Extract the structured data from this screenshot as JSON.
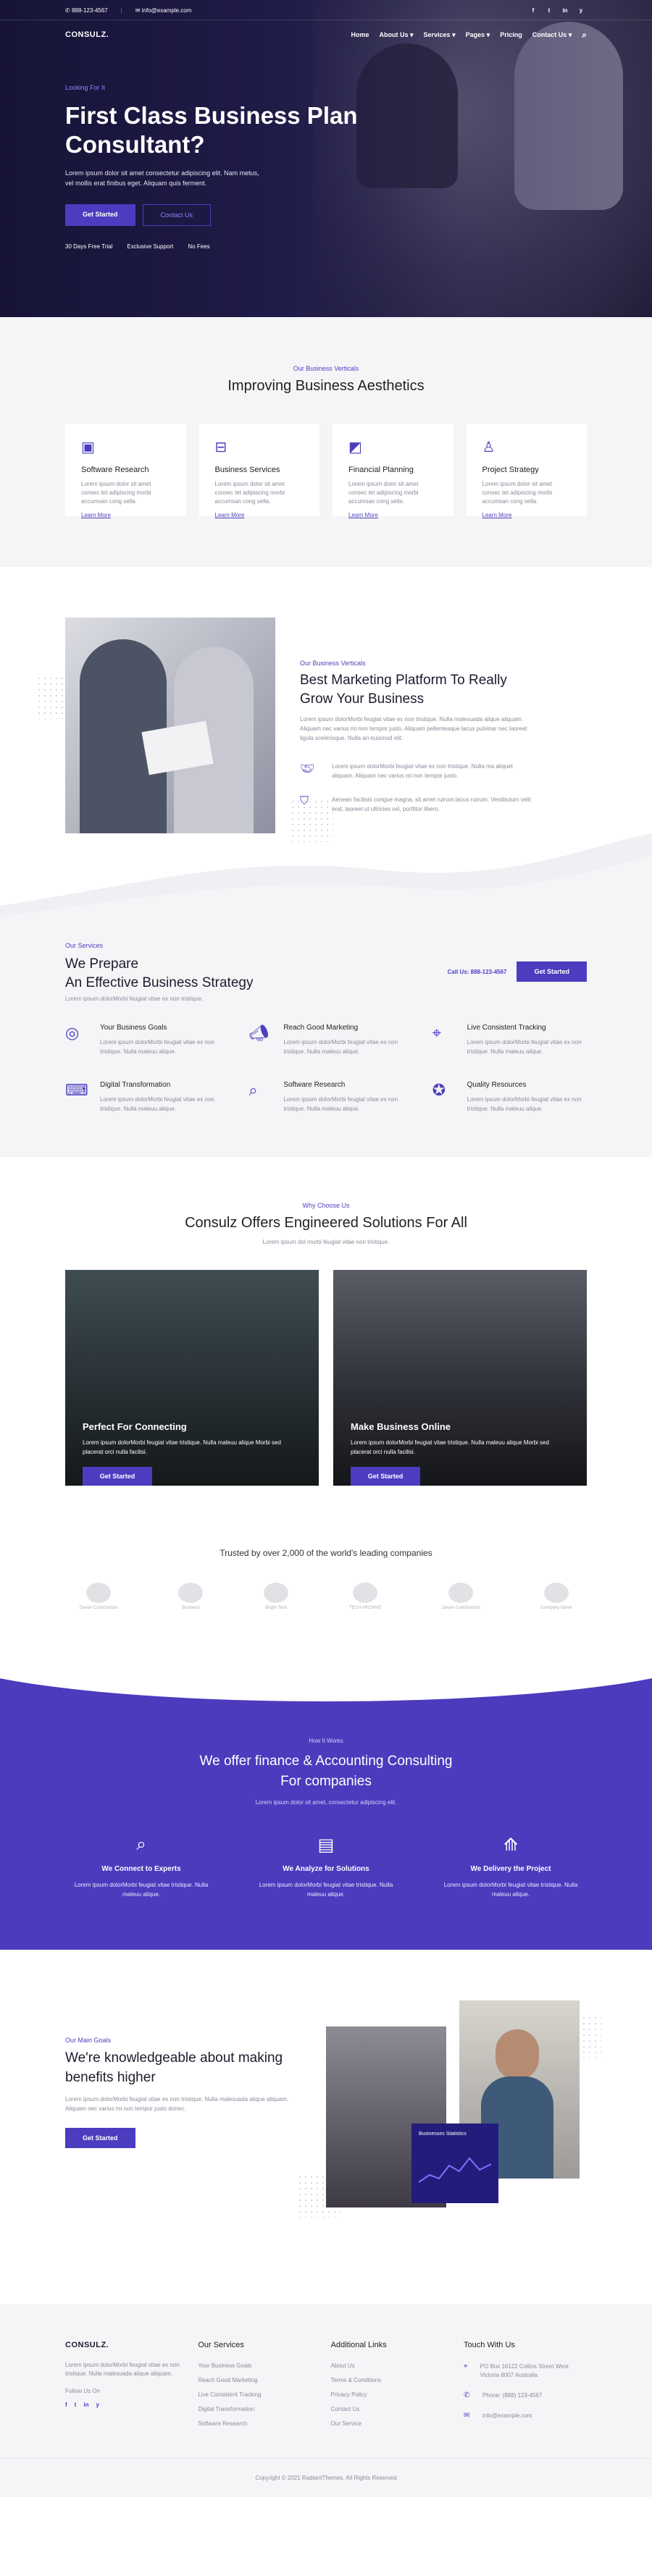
{
  "topbar": {
    "phone": "888-123-4567",
    "email": "info@example.com",
    "social": [
      "f",
      "t",
      "in",
      "y"
    ]
  },
  "nav": {
    "logo": "CONSULZ.",
    "items": [
      "Home",
      "About Us",
      "Services",
      "Pages",
      "Pricing",
      "Contact Us"
    ]
  },
  "hero": {
    "kicker": "Looking For It",
    "title": "First Class Business Plan Consultant?",
    "text": "Lorem ipsum dolor sit amet consectetur adipiscing elit. Nam metus, vel mollis erat finibus eget. Aliquam quis ferment.",
    "btn_primary": "Get Started",
    "btn_secondary": "Contact Us",
    "features": [
      "30 Days Free Trial",
      "Exclusive Support",
      "No Fees"
    ]
  },
  "verticals": {
    "kicker": "Our Business Verticals",
    "title": "Improving Business Aesthetics",
    "cards": [
      {
        "title": "Software Research",
        "text": "Lorem ipsum dolor sit amet consec tet adipiscing morbi accumsan cong sella.",
        "link": "Learn More"
      },
      {
        "title": "Business Services",
        "text": "Lorem ipsum dolor sit amet consec tet adipiscing morbi accumsan cong sella.",
        "link": "Learn More"
      },
      {
        "title": "Financial Planning",
        "text": "Lorem ipsum dolor sit amet consec tet adipiscing morbi accumsan cong sella.",
        "link": "Learn More"
      },
      {
        "title": "Project Strategy",
        "text": "Lorem ipsum dolor sit amet consec tet adipiscing morbi accumsan cong sella.",
        "link": "Learn More"
      }
    ]
  },
  "marketing": {
    "kicker": "Our Business Verticals",
    "title": "Best Marketing Platform To Really Grow Your Business",
    "text": "Lorem ipsum dolorMorbi feugiat vitae ex non tristique. Nulla malesuada alique aliquam. Aliquam nec varius mi non tempor justo. Aliquam pellentesque lacus pulvinar nec laoreet ligula scelerisque. Nulla an euismod elit.",
    "features": [
      "Lorem ipsum dolorMorbi feugiat vitae ex non tristique. Nulla ma aliquet aliquam. Aliquam nec varius mi non tempor justo.",
      "Aenean facilisis congue magna, sit amet rutrum lacus rutrum. Vestibulum velit erat, laoreet ut ultricies vel, porttitor libero."
    ]
  },
  "services": {
    "kicker": "Our Services",
    "title1": "We Prepare",
    "title2": "An Effective Business Strategy",
    "sub": "Lorem ipsum dolorMorbi feugiat vitae ex non tristique.",
    "call": "Call Us: 888-123-4567",
    "btn": "Get Started",
    "items": [
      {
        "title": "Your Business Goals",
        "text": "Lorem ipsum dolorMorbi feugiat vitae ex non tristique. Nulla maleuu alique."
      },
      {
        "title": "Reach Good Marketing",
        "text": "Lorem ipsum dolorMorbi feugiat vitae ex non tristique. Nulla maleuu alique."
      },
      {
        "title": "Live Consistent Tracking",
        "text": "Lorem ipsum dolorMorbi feugiat vitae ex non tristique. Nulla maleuu alique."
      },
      {
        "title": "Digital Transformation",
        "text": "Lorem ipsum dolorMorbi feugiat vitae ex non tristique. Nulla maleuu alique."
      },
      {
        "title": "Software Research",
        "text": "Lorem ipsum dolorMorbi feugiat vitae ex non tristique. Nulla maleuu alique."
      },
      {
        "title": "Quality Resources",
        "text": "Lorem ipsum dolorMorbi feugiat vitae ex non tristique. Nulla maleuu alique."
      }
    ]
  },
  "why": {
    "kicker": "Why Choose Us",
    "title": "Consulz Offers Engineered Solutions For All",
    "sub": "Lorem ipsum dol morbi feugiat vitae non tristique.",
    "cards": [
      {
        "title": "Perfect For Connecting",
        "text": "Lorem ipsum dolorMorbi feugiat vitae tristique. Nulla maleuu alique Morbi sed placerat orci nulla facilisi.",
        "btn": "Get Started"
      },
      {
        "title": "Make Business Online",
        "text": "Lorem ipsum dolorMorbi feugiat vitae tristique. Nulla maleuu alique Morbi sed placerat orci nulla facilisi.",
        "btn": "Get Started"
      }
    ],
    "trusted": "Trusted by over 2,000 of the world's leading companies",
    "logos": [
      "Devon Construction",
      "Business",
      "Bright Tech",
      "TECH ARCHIVE",
      "Devon Construction",
      "Company Name"
    ]
  },
  "how": {
    "kicker": "How It Works",
    "title1": "We offer finance & Accounting Consulting",
    "title2": "For companies",
    "sub": "Lorem ipsum dolor sit amet, consectetur adipiscing elit.",
    "steps": [
      {
        "title": "We Connect to Experts",
        "text": "Lorem ipsum dolorMorbi feugiat vitae tristique. Nulla maleuu alique."
      },
      {
        "title": "We Analyze for Solutions",
        "text": "Lorem ipsum dolorMorbi feugiat vitae tristique. Nulla maleuu alique."
      },
      {
        "title": "We Delivery the Project",
        "text": "Lorem ipsum dolorMorbi feugiat vitae tristique. Nulla maleuu alique."
      }
    ]
  },
  "know": {
    "kicker": "Our Main Goals",
    "title": "We're knowledgeable about making benefits higher",
    "text": "Lorem ipsum dolorMorbi feugiat vitae ex non tristique. Nulla malesuada alique aliquam. Aliquam nec varius mi non tempor justo donec.",
    "btn": "Get Started",
    "card_title": "Businesses Statistics"
  },
  "footer": {
    "logo": "CONSULZ.",
    "about": "Lorem ipsum dolorMorbi feugiat vitae ex non tristique. Nulla malesuada alique aliquam.",
    "follow": "Follow Us On",
    "social": [
      "f",
      "t",
      "in",
      "y"
    ],
    "services_title": "Our Services",
    "services": [
      "Your Business Goals",
      "Reach Good Marketing",
      "Live Consistent Tracking",
      "Digital Transformation",
      "Software Research"
    ],
    "links_title": "Additional Links",
    "links": [
      "About Us",
      "Terms & Conditions",
      "Privacy Policy",
      "Contact Us",
      "Our Service"
    ],
    "touch_title": "Touch With Us",
    "address": "PO Box 16122 Collins Street West Victoria 8007 Australia",
    "phone": "Phone: (888) 123-4567",
    "email": "info@example.com",
    "copyright": "Copyright © 2021 RadiantThemes. All Rights Reserved"
  }
}
